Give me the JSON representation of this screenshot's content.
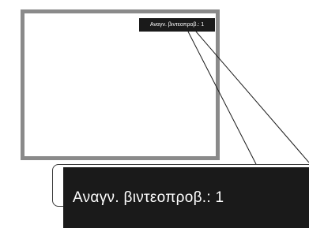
{
  "overlay": {
    "badge_text": "Αναγν. βιντεοπροβ.:  1",
    "zoom_text": "Αναγν. βιντεοπροβ.:  1"
  },
  "colors": {
    "frame_border": "#8a8a8a",
    "badge_background": "#1a1a1a",
    "badge_text": "#ffffff"
  }
}
